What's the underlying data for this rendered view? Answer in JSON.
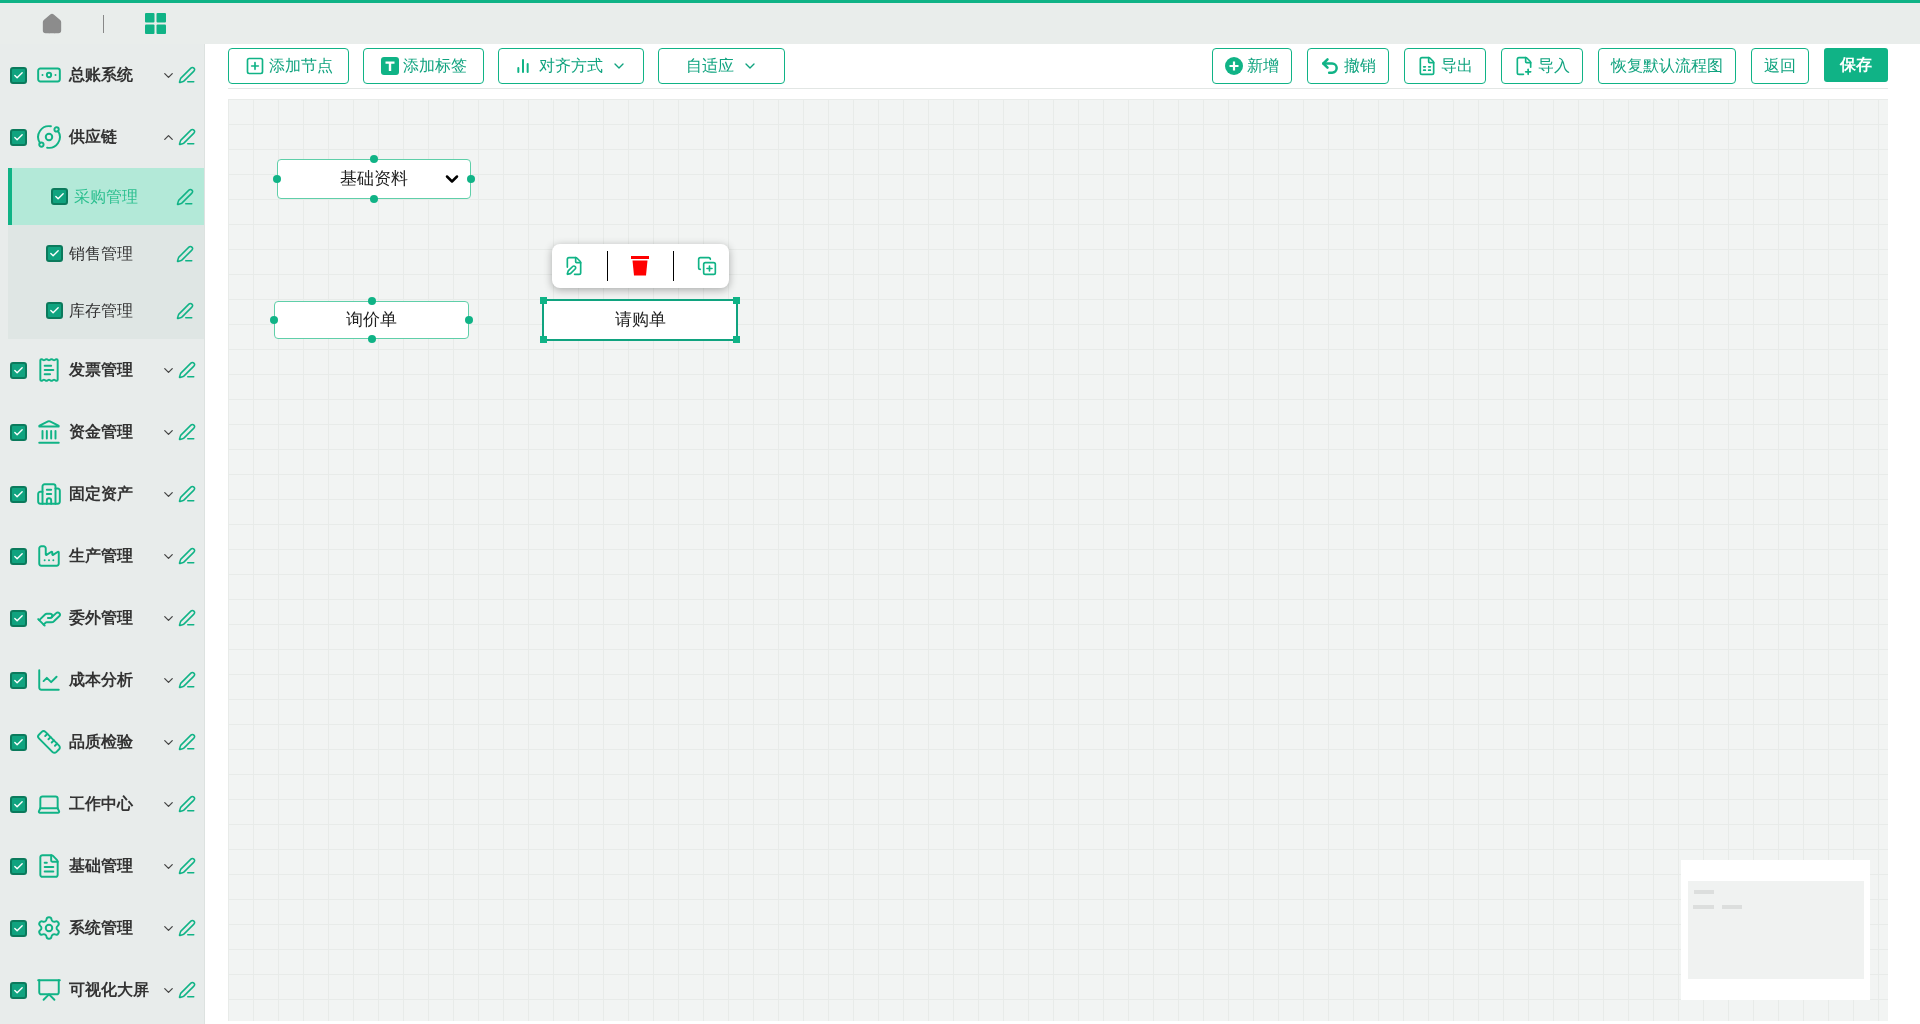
{
  "sidebar": {
    "items": [
      {
        "label": "总账系统",
        "checked": true,
        "expanded": false
      },
      {
        "label": "供应链",
        "checked": true,
        "expanded": true,
        "children": [
          {
            "label": "采购管理",
            "checked": true,
            "selected": true
          },
          {
            "label": "销售管理",
            "checked": true,
            "selected": false
          },
          {
            "label": "库存管理",
            "checked": true,
            "selected": false
          }
        ]
      },
      {
        "label": "发票管理",
        "checked": true,
        "expanded": false
      },
      {
        "label": "资金管理",
        "checked": true,
        "expanded": false
      },
      {
        "label": "固定资产",
        "checked": true,
        "expanded": false
      },
      {
        "label": "生产管理",
        "checked": true,
        "expanded": false
      },
      {
        "label": "委外管理",
        "checked": true,
        "expanded": false
      },
      {
        "label": "成本分析",
        "checked": true,
        "expanded": false
      },
      {
        "label": "品质检验",
        "checked": true,
        "expanded": false
      },
      {
        "label": "工作中心",
        "checked": true,
        "expanded": false
      },
      {
        "label": "基础管理",
        "checked": true,
        "expanded": false
      },
      {
        "label": "系统管理",
        "checked": true,
        "expanded": false
      },
      {
        "label": "可视化大屏",
        "checked": true,
        "expanded": false
      }
    ]
  },
  "toolbar": {
    "left": [
      {
        "label": "添加节点",
        "kind": "button"
      },
      {
        "label": "添加标签",
        "kind": "button"
      },
      {
        "label": "对齐方式",
        "kind": "dropdown"
      },
      {
        "label": "自适应",
        "kind": "dropdown"
      }
    ],
    "right": [
      {
        "label": "新增",
        "kind": "button"
      },
      {
        "label": "撤销",
        "kind": "button"
      },
      {
        "label": "导出",
        "kind": "button"
      },
      {
        "label": "导入",
        "kind": "button"
      },
      {
        "label": "恢复默认流程图",
        "kind": "button"
      },
      {
        "label": "返回",
        "kind": "button"
      },
      {
        "label": "保存",
        "kind": "primary"
      }
    ]
  },
  "canvas": {
    "nodes": [
      {
        "label": "基础资料",
        "kind": "group",
        "selected": false
      },
      {
        "label": "询价单",
        "kind": "node",
        "selected": false
      },
      {
        "label": "请购单",
        "kind": "node",
        "selected": true
      }
    ]
  }
}
